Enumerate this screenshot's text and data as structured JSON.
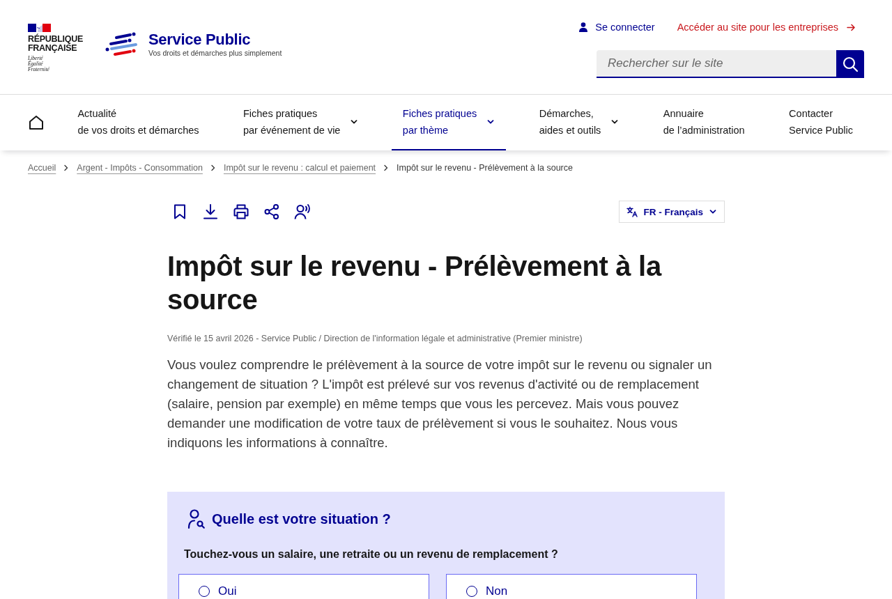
{
  "header": {
    "government_logo": {
      "name_lines": [
        "RÉPUBLIQUE",
        "FRANÇAISE"
      ],
      "motto_lines": [
        "Liberté",
        "Égalité",
        "Fraternité"
      ]
    },
    "site_logo": {
      "name": "Service Public",
      "tagline": "Vos droits et démarches plus simplement"
    },
    "login_link": "Se connecter",
    "business_link": "Accéder au site pour les entreprises",
    "search": {
      "placeholder": "Rechercher sur le site"
    }
  },
  "nav": {
    "items": [
      {
        "lines": [
          "Actualité",
          "de vos droits et démarches"
        ],
        "dropdown": false,
        "selected": false
      },
      {
        "lines": [
          "Fiches pratiques",
          "par événement de vie"
        ],
        "dropdown": true,
        "selected": false
      },
      {
        "lines": [
          "Fiches pratiques",
          "par thème"
        ],
        "dropdown": true,
        "selected": true
      },
      {
        "lines": [
          "Démarches,",
          "aides et outils"
        ],
        "dropdown": true,
        "selected": false
      },
      {
        "lines": [
          "Annuaire",
          "de l’administration"
        ],
        "dropdown": false,
        "selected": false
      },
      {
        "lines": [
          "Contacter",
          "Service Public"
        ],
        "dropdown": false,
        "selected": false
      }
    ]
  },
  "breadcrumb": [
    {
      "label": "Accueil",
      "current": false
    },
    {
      "label": "Argent - Impôts - Consommation",
      "current": false
    },
    {
      "label": "Impôt sur le revenu : calcul et paiement",
      "current": false
    },
    {
      "label": "Impôt sur le revenu - Prélèvement à la source",
      "current": true
    }
  ],
  "toolbar": {
    "language": "FR - Français"
  },
  "article": {
    "title": "Impôt sur le revenu - Prélèvement à la source",
    "meta": "Vérifié le 15 avril 2026 - Service Public / Direction de l'information légale et administrative (Premier ministre)",
    "intro": "Vous voulez comprendre le prélèvement à la source de votre impôt sur le revenu ou signaler un changement de situation ? L'impôt est prélevé sur vos revenus d'activité ou de remplacement (salaire, pension par exemple) en même temps que vous les percevez. Mais vous pouvez demander une modification de votre taux de prélèvement si vous le souhaitez. Nous vous indiquons les informations à connaître."
  },
  "situation": {
    "title": "Quelle est votre situation ?",
    "question": "Touchez-vous un salaire, une retraite ou un revenu de remplacement ?",
    "options": [
      {
        "label": "Oui",
        "selected": false
      },
      {
        "label": "Non",
        "selected": false
      }
    ]
  }
}
